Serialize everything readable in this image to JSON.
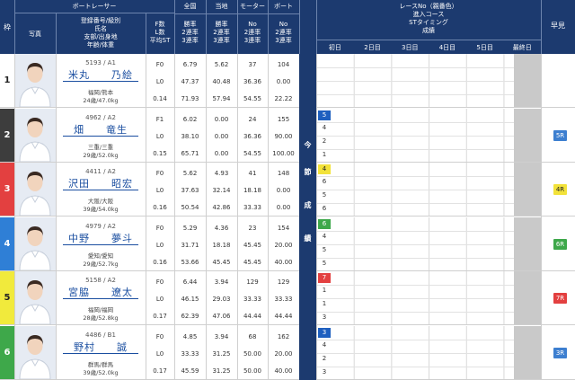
{
  "header": {
    "frame_label": "枠",
    "boat_racer_label": "ボートレーサー",
    "photo_label": "写真",
    "racer_info_lines": [
      "登録番号/級別",
      "氏名",
      "支部/出身地",
      "年齢/体重"
    ],
    "f_info_lines": [
      "F数",
      "L数",
      "平均ST"
    ],
    "national_label": "全国",
    "national_lines": [
      "勝率",
      "2連率",
      "3連率"
    ],
    "local_label": "当地",
    "local_lines": [
      "勝率",
      "2連率",
      "3連率"
    ],
    "motor_label": "モーター",
    "motor_lines": [
      "No",
      "2連率",
      "3連率"
    ],
    "boat_label": "ボート",
    "boat_lines": [
      "No",
      "2連率",
      "3連率"
    ],
    "race_info_lines": [
      "レースNo（親番色）",
      "進入コース",
      "STタイミング",
      "成績"
    ],
    "days": [
      "初日",
      "2日目",
      "3日目",
      "4日目",
      "5日目",
      "最終日"
    ],
    "early_label": "早見",
    "current_series_chars": [
      "今",
      "節",
      "成",
      "績"
    ]
  },
  "racers": [
    {
      "frame": "1",
      "id_class": "5193 / A1",
      "name": "米丸　　乃絵",
      "origin": "福岡/熊本",
      "physique": "24歳/47.0kg",
      "f": "F0",
      "l": "L0",
      "st": "0.14",
      "nat": [
        "6.79",
        "47.37",
        "71.93"
      ],
      "loc": [
        "5.62",
        "40.48",
        "57.94"
      ],
      "motor": [
        "37",
        "36.36",
        "54.55"
      ],
      "boat": [
        "104",
        "0.00",
        "22.22"
      ],
      "cur": [
        "",
        "",
        "",
        ""
      ],
      "early": "",
      "frame_color": "#ffffff",
      "frame_text": "#222222",
      "cur_color": "#ffffff",
      "early_color": "#ffffff"
    },
    {
      "frame": "2",
      "id_class": "4962 / A2",
      "name": "畑　　竜生",
      "origin": "三重/三重",
      "physique": "29歳/52.0kg",
      "f": "F1",
      "l": "L0",
      "st": "0.15",
      "nat": [
        "6.02",
        "38.10",
        "65.71"
      ],
      "loc": [
        "0.00",
        "0.00",
        "0.00"
      ],
      "motor": [
        "24",
        "36.36",
        "54.55"
      ],
      "boat": [
        "155",
        "90.00",
        "100.00"
      ],
      "cur": [
        "5",
        "4",
        "2",
        "1"
      ],
      "early": "5R",
      "frame_color": "#3d3d3d",
      "frame_text": "#ffffff",
      "cur_color": "#1e5fbf",
      "early_color": "#3d7fd0"
    },
    {
      "frame": "3",
      "id_class": "4411 / A2",
      "name": "沢田　　昭宏",
      "origin": "大阪/大阪",
      "physique": "39歳/54.0kg",
      "f": "F0",
      "l": "L0",
      "st": "0.16",
      "nat": [
        "5.62",
        "37.63",
        "50.54"
      ],
      "loc": [
        "4.93",
        "32.14",
        "42.86"
      ],
      "motor": [
        "41",
        "18.18",
        "33.33"
      ],
      "boat": [
        "148",
        "0.00",
        "0.00"
      ],
      "cur": [
        "4",
        "6",
        "5",
        "6"
      ],
      "early": "4R",
      "frame_color": "#e34040",
      "frame_text": "#ffffff",
      "cur_color": "#f2e23a",
      "early_color": "#f2e23a"
    },
    {
      "frame": "4",
      "id_class": "4979 / A2",
      "name": "中野　　夢斗",
      "origin": "愛知/愛知",
      "physique": "29歳/52.7kg",
      "f": "F0",
      "l": "L0",
      "st": "0.16",
      "nat": [
        "5.29",
        "31.71",
        "53.66"
      ],
      "loc": [
        "4.36",
        "18.18",
        "45.45"
      ],
      "motor": [
        "23",
        "45.45",
        "45.45"
      ],
      "boat": [
        "154",
        "20.00",
        "40.00"
      ],
      "cur": [
        "6",
        "4",
        "5",
        "5"
      ],
      "early": "6R",
      "frame_color": "#2f7fd6",
      "frame_text": "#ffffff",
      "cur_color": "#3ea84a",
      "early_color": "#3ea84a"
    },
    {
      "frame": "5",
      "id_class": "5158 / A2",
      "name": "宮脇　　遼太",
      "origin": "福岡/福岡",
      "physique": "28歳/52.8kg",
      "f": "F0",
      "l": "L0",
      "st": "0.17",
      "nat": [
        "6.44",
        "46.15",
        "62.39"
      ],
      "loc": [
        "3.94",
        "29.03",
        "47.06"
      ],
      "motor": [
        "129",
        "33.33",
        "44.44"
      ],
      "boat": [
        "129",
        "33.33",
        "44.44"
      ],
      "cur": [
        "7",
        "1",
        "1",
        "3"
      ],
      "early": "7R",
      "frame_color": "#f1ea3c",
      "frame_text": "#222222",
      "cur_color": "#e34040",
      "early_color": "#e34040"
    },
    {
      "frame": "6",
      "id_class": "4486 / B1",
      "name": "野村　　誠",
      "origin": "群馬/群馬",
      "physique": "39歳/52.0kg",
      "f": "F0",
      "l": "L0",
      "st": "0.17",
      "nat": [
        "4.85",
        "33.33",
        "45.59"
      ],
      "loc": [
        "3.94",
        "31.25",
        "31.25"
      ],
      "motor": [
        "68",
        "50.00",
        "50.00"
      ],
      "boat": [
        "162",
        "20.00",
        "40.00"
      ],
      "cur": [
        "3",
        "4",
        "2",
        "3"
      ],
      "early": "3R",
      "frame_color": "#3ea84a",
      "frame_text": "#ffffff",
      "cur_color": "#1e5fbf",
      "early_color": "#3d7fd0"
    }
  ]
}
